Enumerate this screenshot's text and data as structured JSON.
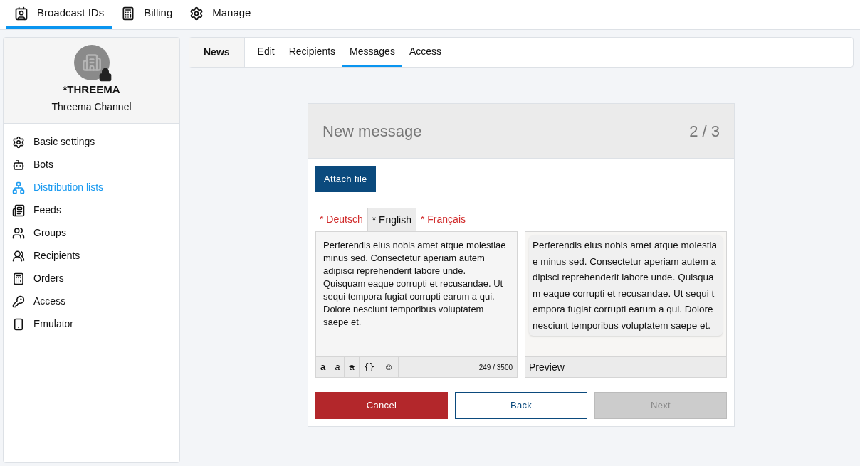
{
  "top_tabs": [
    {
      "label": "Broadcast IDs",
      "selected": true
    },
    {
      "label": "Billing",
      "selected": false
    },
    {
      "label": "Manage",
      "selected": false
    }
  ],
  "profile": {
    "name": "*THREEMA",
    "subtitle": "Threema Channel"
  },
  "sidebar": {
    "items": [
      {
        "label": "Basic settings",
        "selected": false
      },
      {
        "label": "Bots",
        "selected": false
      },
      {
        "label": "Distribution lists",
        "selected": true
      },
      {
        "label": "Feeds",
        "selected": false
      },
      {
        "label": "Groups",
        "selected": false
      },
      {
        "label": "Recipients",
        "selected": false
      },
      {
        "label": "Orders",
        "selected": false
      },
      {
        "label": "Access",
        "selected": false
      },
      {
        "label": "Emulator",
        "selected": false
      }
    ]
  },
  "section": {
    "title": "News",
    "tabs": [
      {
        "label": "Edit",
        "selected": false
      },
      {
        "label": "Recipients",
        "selected": false
      },
      {
        "label": "Messages",
        "selected": true
      },
      {
        "label": "Access",
        "selected": false
      }
    ]
  },
  "card": {
    "title": "New message",
    "step": "2 / 3",
    "attach_button": "Attach file",
    "languages": [
      {
        "label": "* Deutsch",
        "selected": false
      },
      {
        "label": "* English",
        "selected": true
      },
      {
        "label": "* Français",
        "selected": false
      }
    ],
    "message": "Perferendis eius nobis amet atque molestiae minus sed. Consectetur aperiam autem adipisci reprehenderit labore unde. Quisquam eaque corrupti et recusandae. Ut sequi tempora fugiat corrupti earum a qui. Dolore nesciunt temporibus voluptatem saepe et.",
    "format_buttons": [
      {
        "label": "a",
        "kind": "bold"
      },
      {
        "label": "a",
        "kind": "italic"
      },
      {
        "label": "a",
        "kind": "strike"
      },
      {
        "label": "{}",
        "kind": "code"
      },
      {
        "label": "☺",
        "kind": "emoji"
      }
    ],
    "counter": "249 / 3500",
    "preview_text": "Perferendis eius nobis amet atque molestiae minus sed. Consectetur aperiam autem adipisci reprehenderit labore unde. Quisquam eaque corrupti et recusandae. Ut sequi tempora fugiat corrupti earum a qui. Dolore nesciunt temporibus voluptatem saepe et.",
    "preview_label": "Preview",
    "actions": [
      {
        "label": "Cancel",
        "kind": "danger",
        "disabled": false
      },
      {
        "label": "Back",
        "kind": "outline",
        "disabled": false
      },
      {
        "label": "Next",
        "kind": "primary",
        "disabled": true
      }
    ]
  }
}
